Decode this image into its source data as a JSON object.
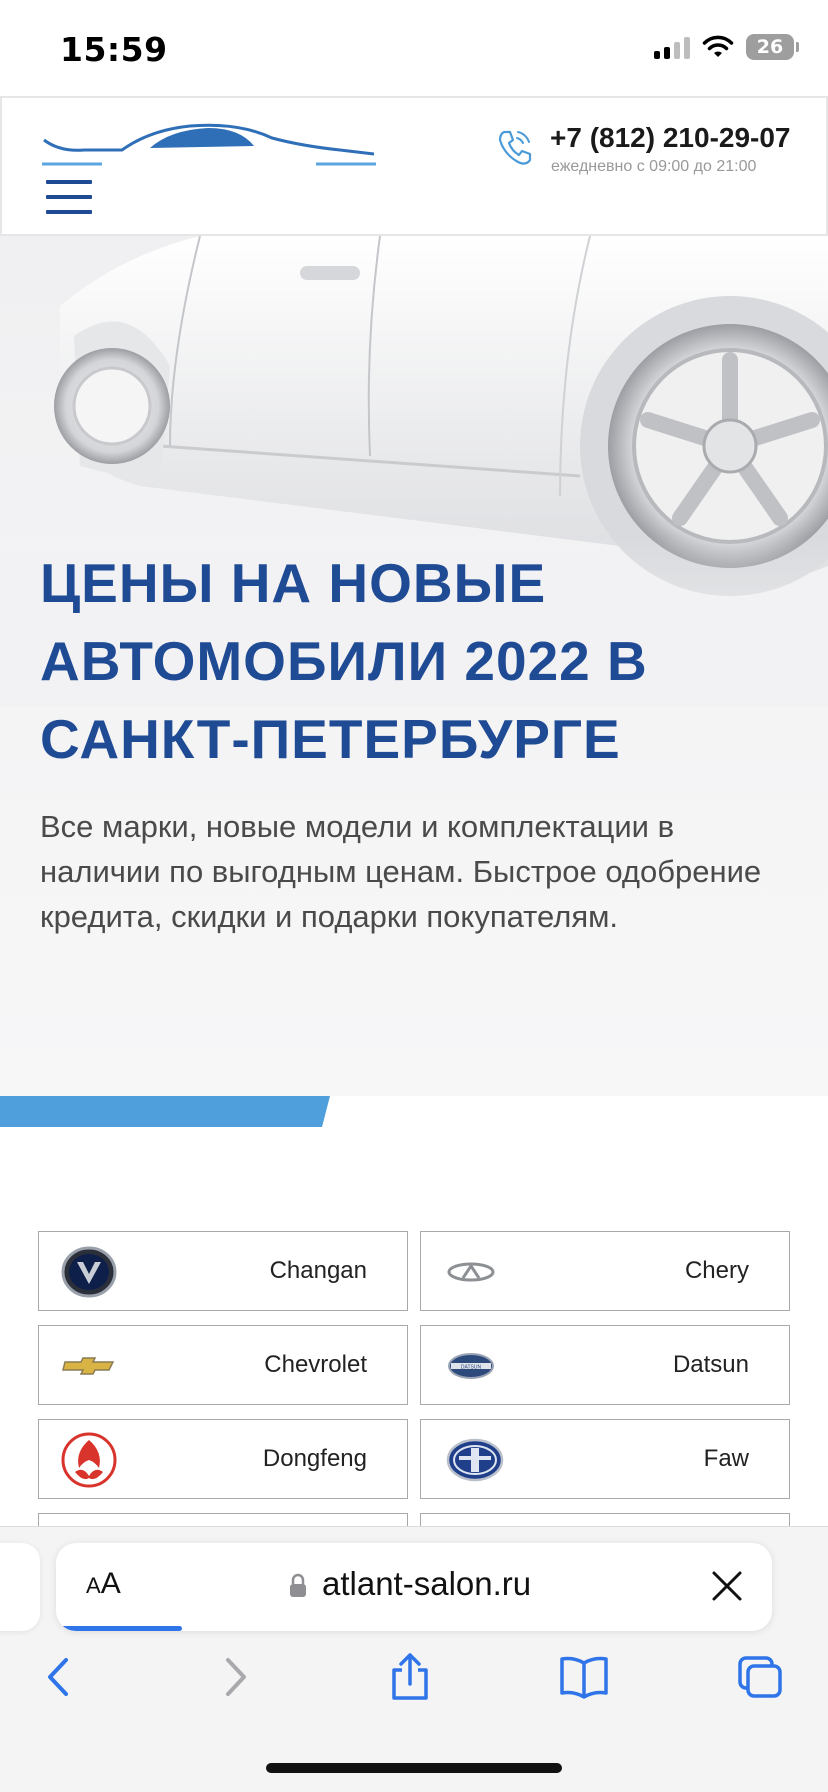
{
  "status_bar": {
    "time": "15:59",
    "battery": "26"
  },
  "header": {
    "phone": "+7 (812) 210-29-07",
    "hours": "ежедневно с 09:00 до 21:00"
  },
  "hero": {
    "title": "ЦЕНЫ НА НОВЫЕ АВТОМОБИЛИ 2022 В САНКТ-ПЕТЕРБУРГЕ",
    "description": "Все марки, новые модели и комплектации в наличии по выгодным ценам. Быстрое одобрение кредита, скидки и подарки покупателям."
  },
  "brands": [
    {
      "name": "Changan",
      "icon": "changan-logo-icon"
    },
    {
      "name": "Chery",
      "icon": "chery-logo-icon"
    },
    {
      "name": "Chevrolet",
      "icon": "chevrolet-logo-icon"
    },
    {
      "name": "Datsun",
      "icon": "datsun-logo-icon"
    },
    {
      "name": "Dongfeng",
      "icon": "dongfeng-logo-icon"
    },
    {
      "name": "Faw",
      "icon": "faw-logo-icon"
    }
  ],
  "browser": {
    "text_size_small": "A",
    "text_size_big": "A",
    "url": "atlant-salon.ru",
    "datsun_badge_text": "DATSUN"
  },
  "colors": {
    "brand_blue": "#1f4a94",
    "accent_light_blue": "#4f9fdc",
    "safari_progress": "#2f74e8"
  }
}
